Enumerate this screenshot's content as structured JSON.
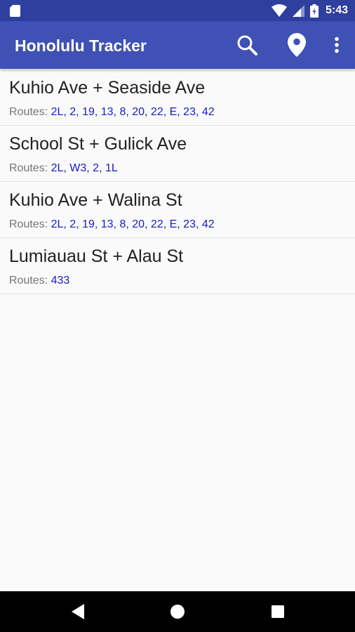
{
  "status_bar": {
    "time": "5:43",
    "icons": [
      "sd-card-icon",
      "wifi-icon",
      "signal-icon",
      "battery-icon"
    ]
  },
  "app_bar": {
    "title": "Honolulu Tracker",
    "actions": [
      "search-icon",
      "location-pin-icon",
      "overflow-menu-icon"
    ]
  },
  "routes_label": "Routes:",
  "stops": [
    {
      "name": "Kuhio Ave + Seaside Ave",
      "routes": "2L, 2, 19, 13, 8, 20, 22, E, 23, 42"
    },
    {
      "name": "School St + Gulick Ave",
      "routes": "2L, W3, 2, 1L"
    },
    {
      "name": "Kuhio Ave + Walina St",
      "routes": "2L, 2, 19, 13, 8, 20, 22, E, 23, 42"
    },
    {
      "name": "Lumiauau St + Alau St",
      "routes": "433"
    }
  ],
  "colors": {
    "status_bar": "#2f3f9f",
    "app_bar": "#3f51b5",
    "route_text": "#1a1ac8",
    "label_text": "#757575"
  },
  "nav_bar": {
    "buttons": [
      "back-icon",
      "home-icon",
      "recents-icon"
    ]
  }
}
